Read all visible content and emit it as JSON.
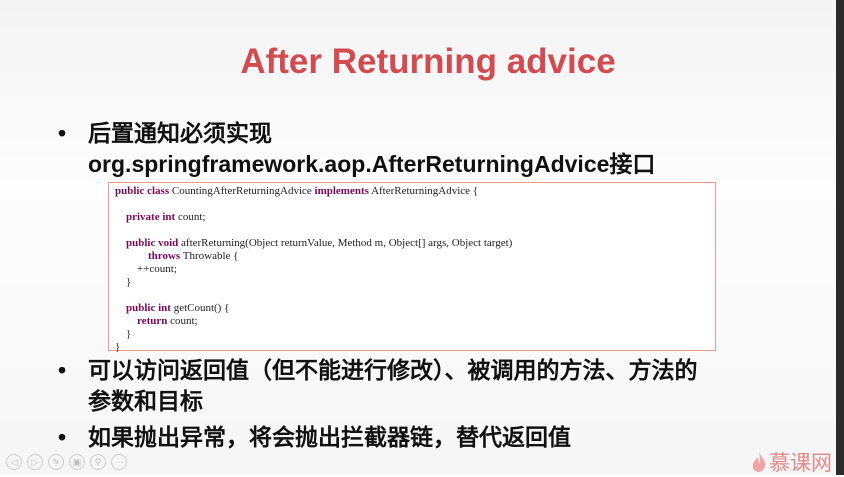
{
  "title": "After Returning advice",
  "bullets": [
    {
      "line1": "后置通知必须实现",
      "line2": "org.springframework.aop.AfterReturningAdvice接口"
    },
    {
      "line1": "可以访问返回值（但不能进行修改）、被调用的方法、方法的",
      "line2": "参数和目标"
    },
    {
      "line1": "如果抛出异常，将会抛出拦截器链，替代返回值"
    }
  ],
  "code": {
    "l1a": "public class",
    "l1b": " CountingAfterReturningAdvice ",
    "l1c": "implements",
    "l1d": " AfterReturningAdvice {",
    "l2a": "private int",
    "l2b": " count;",
    "l3a": "public void",
    "l3b": " afterReturning(Object returnValue, Method m, Object[] args, Object target)",
    "l4a": "throws",
    "l4b": " Throwable {",
    "l5": "++count;",
    "l6": "}",
    "l7a": "public int",
    "l7b": " getCount() {",
    "l8a": "return",
    "l8b": " count;",
    "l9": "}",
    "l10": "}"
  },
  "nav": [
    "◁",
    "▷",
    "✎",
    "▣",
    "⚲",
    "···"
  ],
  "logo": "慕课网",
  "bullet_glyph": "•"
}
